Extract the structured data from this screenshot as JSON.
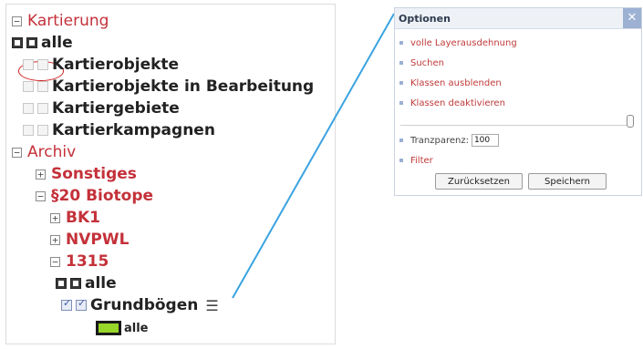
{
  "tree": {
    "kartierung": "Kartierung",
    "alle_1": "alle",
    "kartierobjekte": "Kartierobjekte",
    "kartierobjekte_bearbeitung": "Kartierobjekte in Bearbeitung",
    "kartiergebiete": "Kartiergebiete",
    "kartierkampagnen": "Kartierkampagnen",
    "archiv": "Archiv",
    "sonstiges": "Sonstiges",
    "biotope": "§20 Biotope",
    "bk1": "BK1",
    "nvpwl": "NVPWL",
    "n1315": "1315",
    "alle_2": "alle",
    "grundboegen": "Grundbögen",
    "legend_label": "alle"
  },
  "panel": {
    "title": "Optionen",
    "opt_layer_extent": "volle Layerausdehnung",
    "opt_search": "Suchen",
    "opt_hide_classes": "Klassen ausblenden",
    "opt_disable_classes": "Klassen deaktivieren",
    "transparency_label": "Tranzparenz:",
    "transparency_value": "100",
    "filter": "Filter",
    "reset_button": "Zurücksetzen",
    "save_button": "Speichern"
  },
  "colors": {
    "group_text": "#c4313a",
    "legend_fill": "#99d62a",
    "callout_line": "#3aa3e0",
    "highlight_ellipse": "#d32020"
  }
}
